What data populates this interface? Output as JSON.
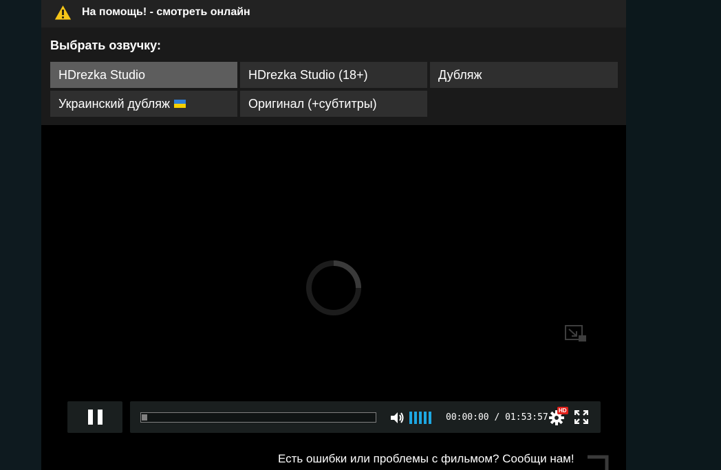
{
  "warning": {
    "icon": "warning-triangle-icon",
    "text": "На помощь! - смотреть онлайн"
  },
  "voice": {
    "title": "Выбрать озвучку:",
    "options": [
      {
        "label": "HDrezka Studio",
        "active": true
      },
      {
        "label": "HDrezka Studio (18+)",
        "active": false
      },
      {
        "label": "Дубляж",
        "active": false
      },
      {
        "label": "Украинский дубляж",
        "active": false,
        "icon": "ukraine-flag-icon"
      },
      {
        "label": "Оригинал (+субтитры)",
        "active": false
      }
    ]
  },
  "player": {
    "state": "loading",
    "progress": 0.02,
    "volume_level": 1.0,
    "time_current": "00:00:00",
    "time_separator": "/",
    "time_total": "01:53:57",
    "quality_badge": "HD",
    "accent_color": "#1ea7e1",
    "badge_color": "#e0211b"
  },
  "report": {
    "text": "Есть ошибки или проблемы с фильмом? Сообщи нам!"
  }
}
